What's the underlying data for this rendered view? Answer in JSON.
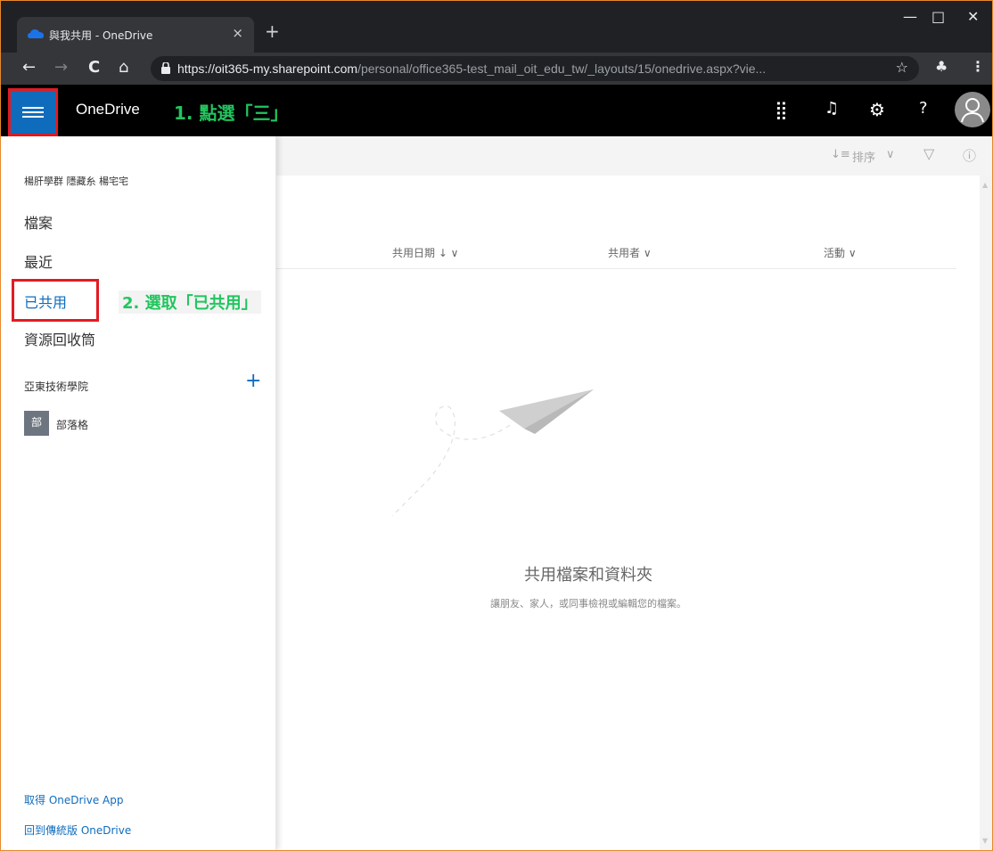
{
  "browser": {
    "tab_title": "與我共用 - OneDrive",
    "tab_close": "×",
    "new_tab": "+",
    "url_host": "https://oit365-my.sharepoint.com",
    "url_path": "/personal/office365-test_mail_oit_edu_tw/_layouts/15/onedrive.aspx?vie...",
    "back": "←",
    "forward": "→",
    "reload": "C",
    "home": "⌂",
    "star": "☆",
    "incognito": "♣",
    "menu": "⋮",
    "minimize": "—",
    "maximize": "□",
    "close": "✕"
  },
  "suitebar": {
    "brand": "OneDrive",
    "annotation_step1": "1. 點選「三」",
    "apps_icon": "⣿",
    "notify_icon": "♫",
    "settings_icon": "⚙",
    "help_icon": "?"
  },
  "command_bar": {
    "sort_icon": "↓≡",
    "sort_label": "排序",
    "sort_chevron": "∨",
    "filter_icon": "▽",
    "info_icon": "ⓘ"
  },
  "list": {
    "columns": [
      {
        "label": "共用日期 ↓ ∨"
      },
      {
        "label": "共用者 ∨"
      },
      {
        "label": "活動 ∨"
      }
    ],
    "empty_title": "共用檔案和資料夾",
    "empty_subtitle": "讓朋友、家人，或同事檢視或編輯您的檔案。"
  },
  "leftnav": {
    "user": "楊肝學群 隱藏糸 楊宅宅",
    "items": [
      {
        "label": "檔案",
        "active": false
      },
      {
        "label": "最近",
        "active": false
      },
      {
        "label": "已共用",
        "active": true
      },
      {
        "label": "資源回收筒",
        "active": false
      }
    ],
    "annotation_step2": "2. 選取「已共用」",
    "sites_header": "亞東技術學院",
    "sites_add": "+",
    "site_badge": "部",
    "site_name": "部落格",
    "footer_links": [
      "取得 OneDrive App",
      "回到傳統版 OneDrive"
    ]
  },
  "colors": {
    "accent": "#0f6cbd",
    "annotation": "#22c55e",
    "highlight_box": "#e21b23"
  }
}
